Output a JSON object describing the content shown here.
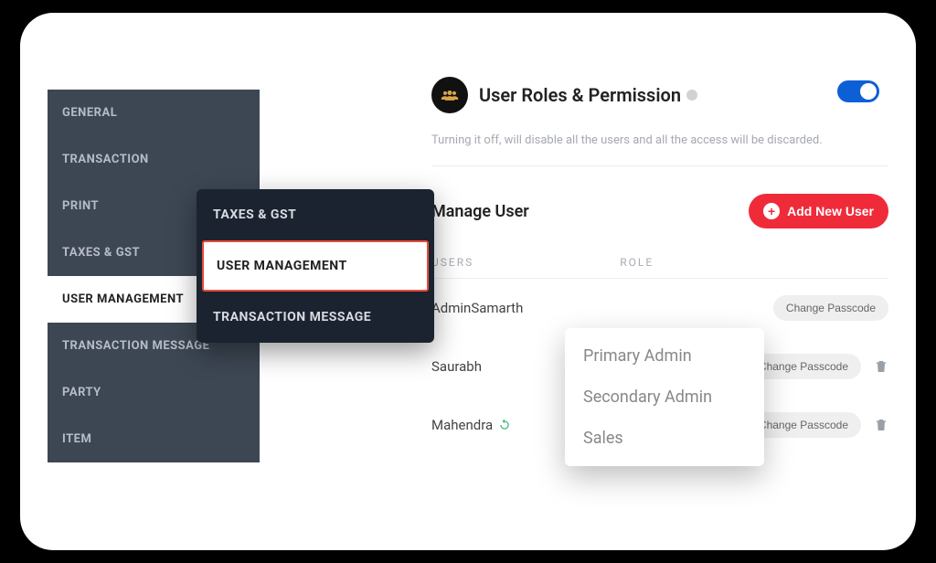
{
  "sidebar": {
    "items": [
      {
        "label": "GENERAL"
      },
      {
        "label": "TRANSACTION"
      },
      {
        "label": "PRINT"
      },
      {
        "label": "TAXES & GST"
      },
      {
        "label": "USER MANAGEMENT"
      },
      {
        "label": "TRANSACTION MESSAGE"
      },
      {
        "label": "PARTY"
      },
      {
        "label": "ITEM"
      }
    ],
    "active_index": 4
  },
  "submenu": {
    "items": [
      {
        "label": "TAXES & GST"
      },
      {
        "label": "USER MANAGEMENT"
      },
      {
        "label": "TRANSACTION MESSAGE"
      }
    ],
    "highlighted_index": 1
  },
  "header": {
    "title": "User Roles & Permission",
    "toggle_on": true,
    "subtext": "Turning it off, will disable all the users and all the access will be discarded."
  },
  "manage": {
    "title": "Manage User",
    "add_label": "Add New User"
  },
  "table": {
    "columns": {
      "users": "USERS",
      "role": "ROLE"
    },
    "rows": [
      {
        "name": "AdminSamarth",
        "passcode_label": "Change Passcode",
        "deletable": false,
        "sync": false
      },
      {
        "name": "Saurabh",
        "passcode_label": "Change Passcode",
        "deletable": true,
        "sync": false
      },
      {
        "name": "Mahendra",
        "passcode_label": "Change Passcode",
        "deletable": true,
        "sync": true
      }
    ]
  },
  "role_options": [
    "Primary Admin",
    "Secondary Admin",
    "Sales"
  ]
}
